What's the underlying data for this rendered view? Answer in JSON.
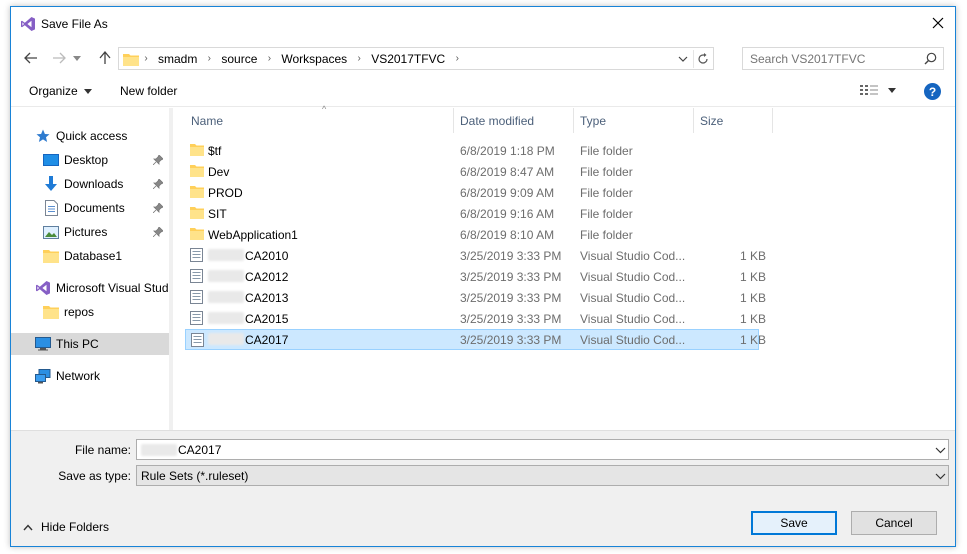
{
  "window": {
    "title": "Save File As",
    "close_icon": "close-icon"
  },
  "navigation": {
    "breadcrumbs": [
      "smadm",
      "source",
      "Workspaces",
      "VS2017TFVC"
    ],
    "search_placeholder": "Search VS2017TFVC"
  },
  "toolbar": {
    "organize_label": "Organize",
    "new_folder_label": "New folder",
    "help_label": "?"
  },
  "sidebar": {
    "items": [
      {
        "label": "Quick access",
        "icon": "star-icon",
        "pinned": false,
        "indent": 1
      },
      {
        "label": "Desktop",
        "icon": "desktop-icon",
        "pinned": true,
        "indent": 2
      },
      {
        "label": "Downloads",
        "icon": "download-arrow-icon",
        "pinned": true,
        "indent": 2
      },
      {
        "label": "Documents",
        "icon": "document-icon",
        "pinned": true,
        "indent": 2
      },
      {
        "label": "Pictures",
        "icon": "pictures-icon",
        "pinned": true,
        "indent": 2
      },
      {
        "label": "Database1",
        "icon": "folder-icon",
        "pinned": false,
        "indent": 2
      },
      {
        "label": "Microsoft Visual Stud",
        "icon": "visual-studio-icon",
        "pinned": false,
        "indent": 1
      },
      {
        "label": "repos",
        "icon": "folder-icon",
        "pinned": false,
        "indent": 2
      },
      {
        "label": "This PC",
        "icon": "computer-icon",
        "pinned": false,
        "indent": 1,
        "selected": true
      },
      {
        "label": "Network",
        "icon": "network-icon",
        "pinned": false,
        "indent": 1
      }
    ]
  },
  "file_list": {
    "columns": [
      "Name",
      "Date modified",
      "Type",
      "Size"
    ],
    "rows": [
      {
        "name": "$tf",
        "date": "6/8/2019 1:18 PM",
        "type": "File folder",
        "size": "",
        "kind": "folder"
      },
      {
        "name": "Dev",
        "date": "6/8/2019 8:47 AM",
        "type": "File folder",
        "size": "",
        "kind": "folder"
      },
      {
        "name": "PROD",
        "date": "6/8/2019 9:09 AM",
        "type": "File folder",
        "size": "",
        "kind": "folder"
      },
      {
        "name": "SIT",
        "date": "6/8/2019 9:16 AM",
        "type": "File folder",
        "size": "",
        "kind": "folder"
      },
      {
        "name": "WebApplication1",
        "date": "6/8/2019 8:10 AM",
        "type": "File folder",
        "size": "",
        "kind": "folder"
      },
      {
        "name": "CA2010",
        "date": "3/25/2019 3:33 PM",
        "type": "Visual Studio Cod...",
        "size": "1 KB",
        "kind": "file"
      },
      {
        "name": "CA2012",
        "date": "3/25/2019 3:33 PM",
        "type": "Visual Studio Cod...",
        "size": "1 KB",
        "kind": "file"
      },
      {
        "name": "CA2013",
        "date": "3/25/2019 3:33 PM",
        "type": "Visual Studio Cod...",
        "size": "1 KB",
        "kind": "file"
      },
      {
        "name": "CA2015",
        "date": "3/25/2019 3:33 PM",
        "type": "Visual Studio Cod...",
        "size": "1 KB",
        "kind": "file"
      },
      {
        "name": "CA2017",
        "date": "3/25/2019 3:33 PM",
        "type": "Visual Studio Cod...",
        "size": "1 KB",
        "kind": "file",
        "selected": true
      }
    ]
  },
  "form": {
    "file_name_label": "File name:",
    "file_name_value": "CA2017",
    "save_as_type_label": "Save as type:",
    "save_as_type_value": "Rule Sets (*.ruleset)"
  },
  "footer": {
    "hide_folders_label": "Hide Folders",
    "save_label": "Save",
    "cancel_label": "Cancel"
  },
  "colors": {
    "accent": "#0078d7",
    "selection": "#cce8ff",
    "folder": "#ffd05a",
    "vs_purple": "#865fc5"
  }
}
